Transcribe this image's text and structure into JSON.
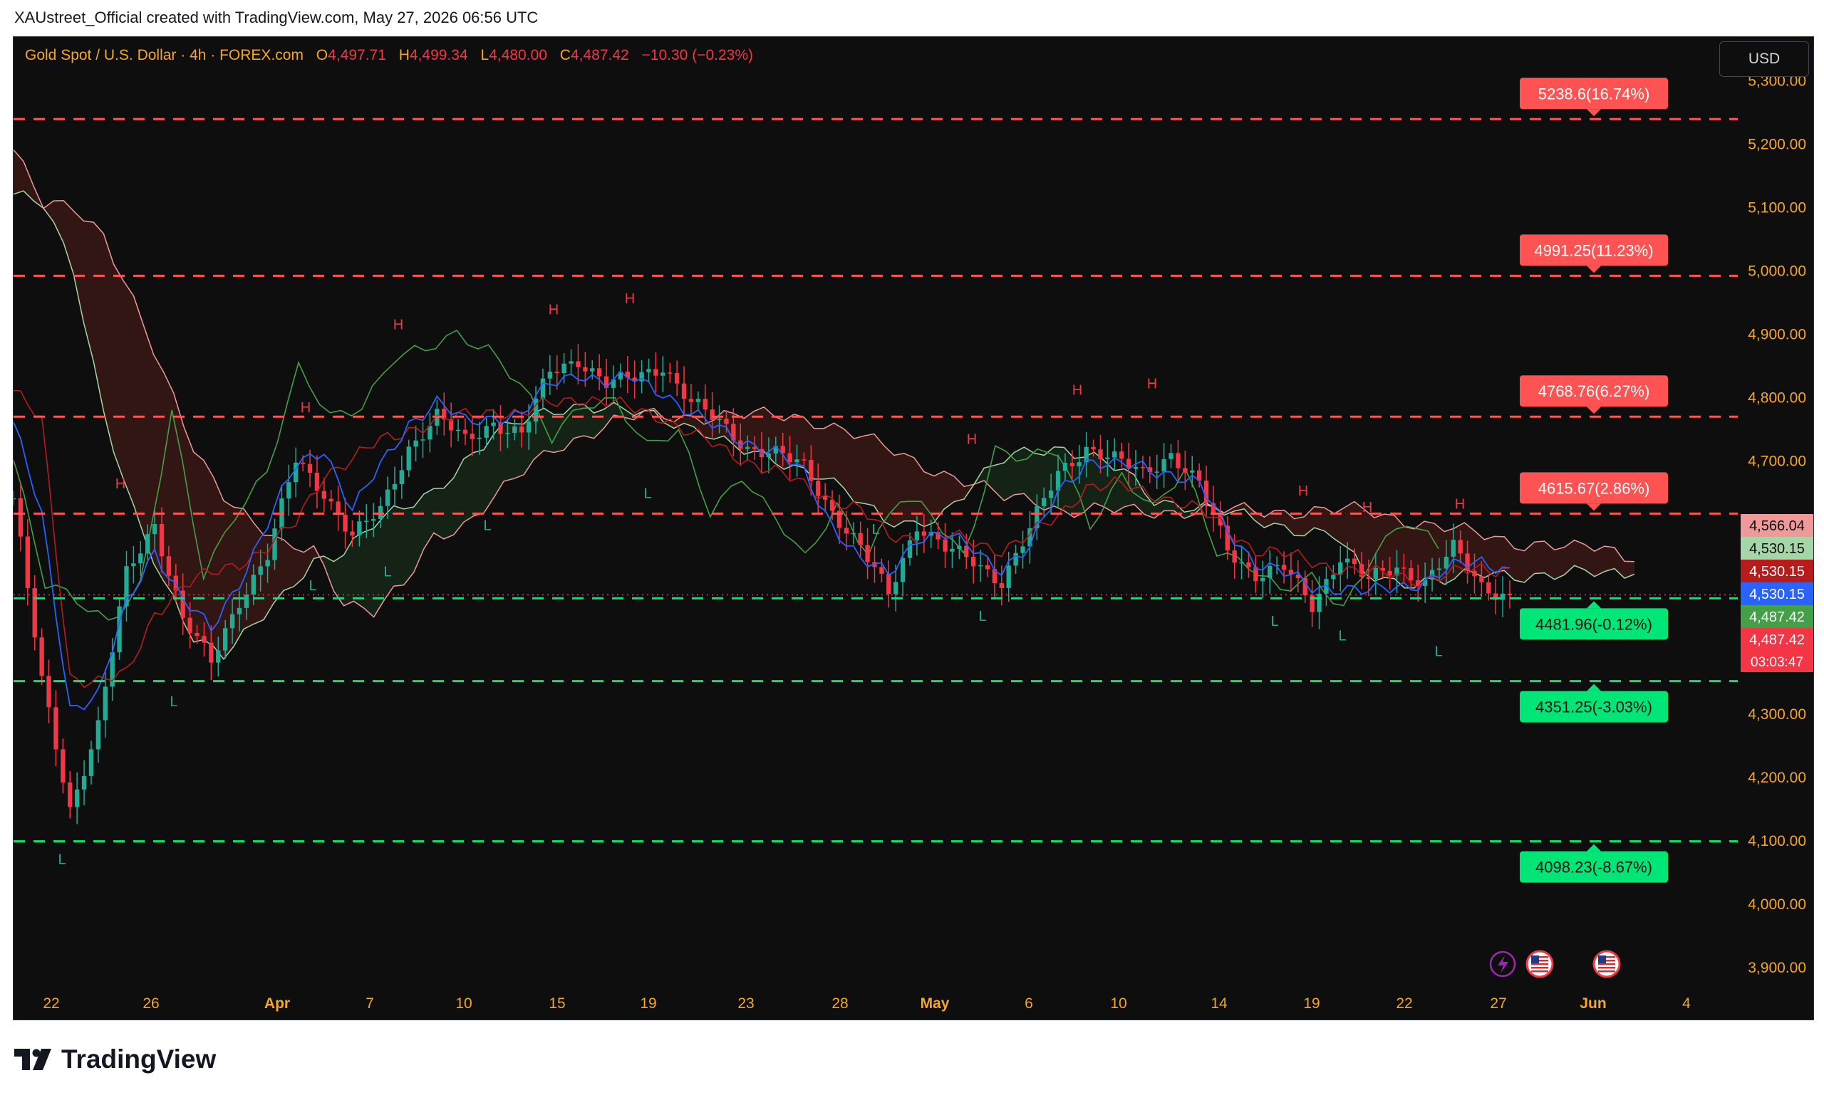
{
  "caption": "XAUstreet_Official created with TradingView.com, May 27, 2026 06:56 UTC",
  "legend": {
    "symbol": "Gold Spot / U.S. Dollar · 4h · FOREX.com",
    "open_label": "O",
    "open": "4,497.71",
    "high_label": "H",
    "high": "4,499.34",
    "low_label": "L",
    "low": "4,480.00",
    "close_label": "C",
    "close": "4,487.42",
    "change": "−10.30 (−0.23%)"
  },
  "currency_button": "USD",
  "brand": "TradingView",
  "colors": {
    "background": "#0e0e0e",
    "axis_text": "#f5a623",
    "bull": "#22ab94",
    "bear": "#f23645",
    "resistance": "#ff5252",
    "support": "#00e676",
    "tenkan": "#2962ff",
    "kijun": "#b71c1c",
    "chikou": "#43a047",
    "senkou_a": "#a5d6a7",
    "senkou_b": "#ef9a9a"
  },
  "chart_data": {
    "type": "candlestick",
    "interval": "4h",
    "ylim": [
      3900,
      5330
    ],
    "y_ticks": [
      "3,900.00",
      "4,000.00",
      "4,100.00",
      "4,200.00",
      "4,300.00",
      "4,400.00",
      "4,500.00",
      "4,600.00",
      "4,700.00",
      "4,800.00",
      "4,900.00",
      "5,000.00",
      "5,100.00",
      "5,200.00",
      "5,300.00"
    ],
    "x_ticks": [
      "22",
      "26",
      "Apr",
      "7",
      "10",
      "15",
      "19",
      "23",
      "28",
      "May",
      "6",
      "10",
      "14",
      "19",
      "22",
      "27",
      "Jun",
      "4"
    ],
    "indicator": "Ichimoku Cloud",
    "levels": [
      {
        "price": 5238.6,
        "label": "5238.6(16.74%)",
        "kind": "resistance"
      },
      {
        "price": 4991.25,
        "label": "4991.25(11.23%)",
        "kind": "resistance"
      },
      {
        "price": 4768.76,
        "label": "4768.76(6.27%)",
        "kind": "resistance"
      },
      {
        "price": 4615.67,
        "label": "4615.67(2.86%)",
        "kind": "resistance"
      },
      {
        "price": 4481.96,
        "label": "4481.96(-0.12%)",
        "kind": "support"
      },
      {
        "price": 4351.25,
        "label": "4351.25(-3.03%)",
        "kind": "support"
      },
      {
        "price": 4098.23,
        "label": "4098.23(-8.67%)",
        "kind": "support"
      }
    ],
    "price_tags": [
      {
        "price": 4566.04,
        "label": "4,566.04",
        "color": "#ef9a9a",
        "text": "#0e0e0e"
      },
      {
        "price": 4530.15,
        "label": "4,530.15",
        "color": "#a5d6a7",
        "text": "#0e0e0e"
      },
      {
        "price": 4530.15,
        "label": "4,530.15",
        "color": "#b71c1c",
        "text": "#ffffff"
      },
      {
        "price": 4530.15,
        "label": "4,530.15",
        "color": "#2962ff",
        "text": "#ffffff"
      },
      {
        "price": 4487.42,
        "label": "4,487.42",
        "color": "#43a047",
        "text": "#ffffff"
      },
      {
        "price": 4487.42,
        "label": "4,487.42",
        "color": "#f23645",
        "text": "#ffffff"
      }
    ],
    "countdown": "03:03:47",
    "pivots": [
      {
        "label": "H",
        "price": 4642
      },
      {
        "label": "H",
        "price": 4762
      },
      {
        "label": "H",
        "price": 4893
      },
      {
        "label": "H",
        "price": 4917
      },
      {
        "label": "H",
        "price": 4934
      },
      {
        "label": "H",
        "price": 4712
      },
      {
        "label": "H",
        "price": 4790
      },
      {
        "label": "H",
        "price": 4800
      },
      {
        "label": "H",
        "price": 4631
      },
      {
        "label": "H",
        "price": 4605
      },
      {
        "label": "H",
        "price": 4610
      },
      {
        "label": "L",
        "price": 4094
      },
      {
        "label": "L",
        "price": 4343
      },
      {
        "label": "L",
        "price": 4526
      },
      {
        "label": "L",
        "price": 4548
      },
      {
        "label": "L",
        "price": 4621
      },
      {
        "label": "L",
        "price": 4672
      },
      {
        "label": "L",
        "price": 4615
      },
      {
        "label": "L",
        "price": 4478
      },
      {
        "label": "L",
        "price": 4470
      },
      {
        "label": "L",
        "price": 4447
      },
      {
        "label": "L",
        "price": 4422
      }
    ],
    "close_path": [
      4640,
      4350,
      4150,
      4280,
      4520,
      4600,
      4450,
      4380,
      4480,
      4550,
      4700,
      4650,
      4580,
      4620,
      4720,
      4770,
      4730,
      4760,
      4740,
      4840,
      4860,
      4820,
      4830,
      4850,
      4790,
      4760,
      4720,
      4710,
      4690,
      4620,
      4560,
      4490,
      4600,
      4560,
      4540,
      4510,
      4590,
      4680,
      4720,
      4700,
      4680,
      4710,
      4660,
      4560,
      4520,
      4530,
      4470,
      4550,
      4510,
      4530,
      4510,
      4560,
      4500,
      4487
    ],
    "tenkan_path": [
      4760,
      4610,
      4310,
      4330,
      4470,
      4560,
      4480,
      4430,
      4510,
      4600,
      4690,
      4720,
      4620,
      4690,
      4760,
      4790,
      4760,
      4770,
      4770,
      4820,
      4840,
      4820,
      4830,
      4810,
      4770,
      4750,
      4730,
      4710,
      4680,
      4600,
      4540,
      4520,
      4580,
      4580,
      4560,
      4530,
      4560,
      4650,
      4700,
      4690,
      4690,
      4680,
      4660,
      4590,
      4540,
      4520,
      4500,
      4500,
      4490,
      4500,
      4510,
      4530,
      4540,
      4530
    ],
    "kijun_path": [
      4810,
      4760,
      4360,
      4350,
      4360,
      4460,
      4500,
      4520,
      4540,
      4560,
      4600,
      4680,
      4700,
      4730,
      4750,
      4760,
      4770,
      4780,
      4770,
      4790,
      4800,
      4790,
      4780,
      4770,
      4740,
      4720,
      4700,
      4680,
      4660,
      4640,
      4620,
      4580,
      4580,
      4580,
      4570,
      4560,
      4580,
      4610,
      4660,
      4660,
      4650,
      4640,
      4620,
      4590,
      4560,
      4550,
      4540,
      4530,
      4520,
      4520,
      4510,
      4520,
      4530,
      4530
    ],
    "chikou_path": [
      4700,
      4500,
      4480,
      4450,
      4500,
      4770,
      4520,
      4620,
      4680,
      4840,
      4770,
      4790,
      4860,
      4870,
      4900,
      4880,
      4820,
      4730,
      4790,
      4800,
      4720,
      4740,
      4620,
      4680,
      4610,
      4540,
      4630,
      4560,
      4640,
      4610,
      4550,
      4720,
      4700,
      4710,
      4600,
      4680,
      4620,
      4680,
      4560,
      4540,
      4490,
      4510,
      4470,
      4560,
      4600,
      4560
    ],
    "senkou_a_path": [
      5120,
      5100,
      5000,
      4780,
      4620,
      4500,
      4420,
      4400,
      4440,
      4480,
      4540,
      4560,
      4600,
      4620,
      4650,
      4700,
      4740,
      4760,
      4780,
      4790,
      4780,
      4770,
      4760,
      4750,
      4720,
      4700,
      4690,
      4680,
      4640,
      4600,
      4600,
      4620,
      4660,
      4700,
      4720,
      4720,
      4700,
      4680,
      4640,
      4630,
      4620,
      4610,
      4600,
      4590,
      4580,
      4520,
      4510,
      4510,
      4510,
      4520,
      4520,
      4520,
      4520,
      4520,
      4520
    ],
    "senkou_b_path": [
      5190,
      5100,
      5100,
      5060,
      4950,
      4830,
      4720,
      4650,
      4600,
      4560,
      4560,
      4480,
      4460,
      4500,
      4580,
      4600,
      4640,
      4680,
      4720,
      4740,
      4760,
      4770,
      4770,
      4770,
      4770,
      4770,
      4770,
      4760,
      4740,
      4720,
      4700,
      4680,
      4660,
      4640,
      4640,
      4620,
      4620,
      4620,
      4620,
      4620,
      4620,
      4620,
      4620,
      4620,
      4620,
      4620,
      4610,
      4600,
      4590,
      4580,
      4570,
      4570,
      4560,
      4560,
      4540
    ]
  }
}
